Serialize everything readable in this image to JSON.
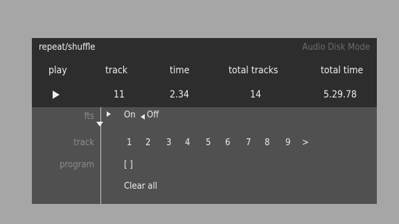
{
  "header": {
    "title": "repeat/shuffle",
    "mode": "Audio Disk Mode",
    "columns": [
      "play",
      "track",
      "time",
      "total tracks",
      "total time"
    ],
    "values": {
      "track": "11",
      "time": "2.34",
      "total_tracks": "14",
      "total_time": "5.29.78"
    }
  },
  "rows": {
    "fts": {
      "label": "fts",
      "on": "On",
      "off": "Off"
    },
    "track": {
      "label": "track",
      "numbers": [
        "1",
        "2",
        "3",
        "4",
        "5",
        "6",
        "7",
        "8",
        "9"
      ],
      "more": ">"
    },
    "program": {
      "label": "program",
      "value": "[ ]"
    },
    "clear_all": "Clear all"
  }
}
